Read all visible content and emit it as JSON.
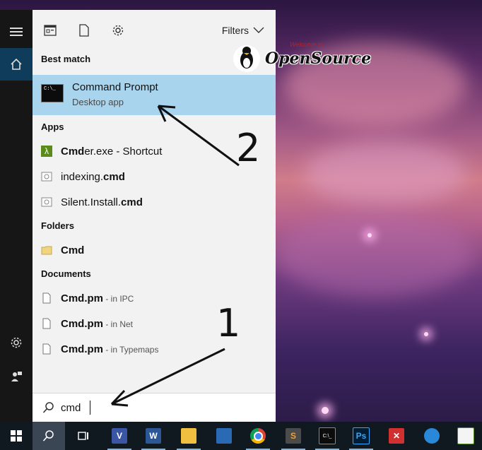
{
  "watermark": {
    "tag": "Welcome to",
    "brand": "OpenSource"
  },
  "topbar": {
    "filters_label": "Filters"
  },
  "best_match": {
    "section_label": "Best match",
    "title": "Command Prompt",
    "subtitle": "Desktop app",
    "icon_text": "C:\\_"
  },
  "apps": {
    "section_label": "Apps",
    "items": [
      {
        "prefix": "Cmd",
        "rest": "er.exe - Shortcut",
        "icon": "lambda-icon"
      },
      {
        "prefix": "indexing.",
        "bold": "cmd",
        "icon": "cmd-file-icon"
      },
      {
        "prefix": "Silent.Install.",
        "bold": "cmd",
        "icon": "cmd-file-icon"
      }
    ]
  },
  "folders": {
    "section_label": "Folders",
    "items": [
      {
        "label": "Cmd",
        "icon": "folder-icon"
      }
    ]
  },
  "documents": {
    "section_label": "Documents",
    "items": [
      {
        "name": "Cmd.pm",
        "location": " - in IPC",
        "icon": "document-icon"
      },
      {
        "name": "Cmd.pm",
        "location": " - in Net",
        "icon": "document-icon"
      },
      {
        "name": "Cmd.pm",
        "location": " - in Typemaps",
        "icon": "document-icon"
      }
    ]
  },
  "search": {
    "value": "cmd"
  },
  "annotations": {
    "one": "1",
    "two": "2"
  },
  "colors": {
    "selection": "#a8d4ee",
    "panel": "#f2f2f2",
    "taskbar": "#101820",
    "accent": "#0f3c5a"
  }
}
